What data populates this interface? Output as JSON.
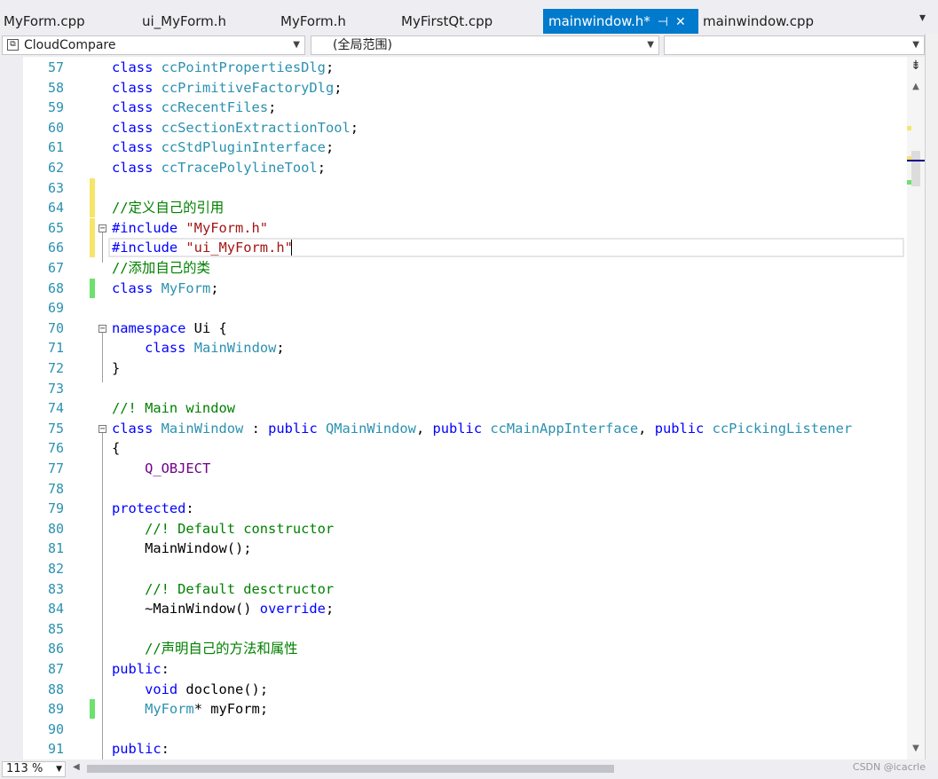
{
  "tabs": [
    {
      "label": "MyForm.cpp"
    },
    {
      "label": "ui_MyForm.h"
    },
    {
      "label": "MyForm.h"
    },
    {
      "label": "MyFirstQt.cpp"
    },
    {
      "label": "mainwindow.h*",
      "active": true
    },
    {
      "label": "mainwindow.cpp"
    }
  ],
  "tab_icons": {
    "pin": "pin-icon",
    "close": "close-icon",
    "menu": "dropdown-icon"
  },
  "nav": {
    "project": "CloudCompare",
    "scope": "(全局范围)",
    "member": ""
  },
  "editor": {
    "current_line": 66,
    "lines": [
      {
        "n": "57",
        "text": "class ccPointPropertiesDlg;"
      },
      {
        "n": "58",
        "text": "class ccPrimitiveFactoryDlg;"
      },
      {
        "n": "59",
        "text": "class ccRecentFiles;"
      },
      {
        "n": "60",
        "text": "class ccSectionExtractionTool;"
      },
      {
        "n": "61",
        "text": "class ccStdPluginInterface;"
      },
      {
        "n": "62",
        "text": "class ccTracePolylineTool;"
      },
      {
        "n": "63",
        "text": ""
      },
      {
        "n": "64",
        "text": "//定义自己的引用"
      },
      {
        "n": "65",
        "text": "#include \"MyForm.h\""
      },
      {
        "n": "66",
        "text": "#include \"ui_MyForm.h\""
      },
      {
        "n": "67",
        "text": "//添加自己的类"
      },
      {
        "n": "68",
        "text": "class MyForm;"
      },
      {
        "n": "69",
        "text": ""
      },
      {
        "n": "70",
        "text": "namespace Ui {"
      },
      {
        "n": "71",
        "text": "    class MainWindow;"
      },
      {
        "n": "72",
        "text": "}"
      },
      {
        "n": "73",
        "text": ""
      },
      {
        "n": "74",
        "text": "//! Main window"
      },
      {
        "n": "75",
        "text": "class MainWindow : public QMainWindow, public ccMainAppInterface, public ccPickingListener"
      },
      {
        "n": "76",
        "text": "{"
      },
      {
        "n": "77",
        "text": "    Q_OBJECT"
      },
      {
        "n": "78",
        "text": ""
      },
      {
        "n": "79",
        "text": "protected:"
      },
      {
        "n": "80",
        "text": "    //! Default constructor"
      },
      {
        "n": "81",
        "text": "    MainWindow();"
      },
      {
        "n": "82",
        "text": ""
      },
      {
        "n": "83",
        "text": "    //! Default desctructor"
      },
      {
        "n": "84",
        "text": "    ~MainWindow() override;"
      },
      {
        "n": "85",
        "text": ""
      },
      {
        "n": "86",
        "text": "    //声明自己的方法和属性"
      },
      {
        "n": "87",
        "text": "public:"
      },
      {
        "n": "88",
        "text": "    void doclone();"
      },
      {
        "n": "89",
        "text": "    MyForm* myForm;"
      },
      {
        "n": "90",
        "text": ""
      },
      {
        "n": "91",
        "text": "public:"
      }
    ]
  },
  "status": {
    "zoom": "113 %",
    "watermark": "CSDN @icacrle"
  },
  "colors": {
    "accent": "#007acc",
    "keyword": "#0000ff",
    "type": "#2b91af",
    "comment": "#008000",
    "string": "#a31515",
    "macro": "#6f008a",
    "changed_saved": "#6ee06e",
    "changed_unsaved": "#f5e56b"
  }
}
